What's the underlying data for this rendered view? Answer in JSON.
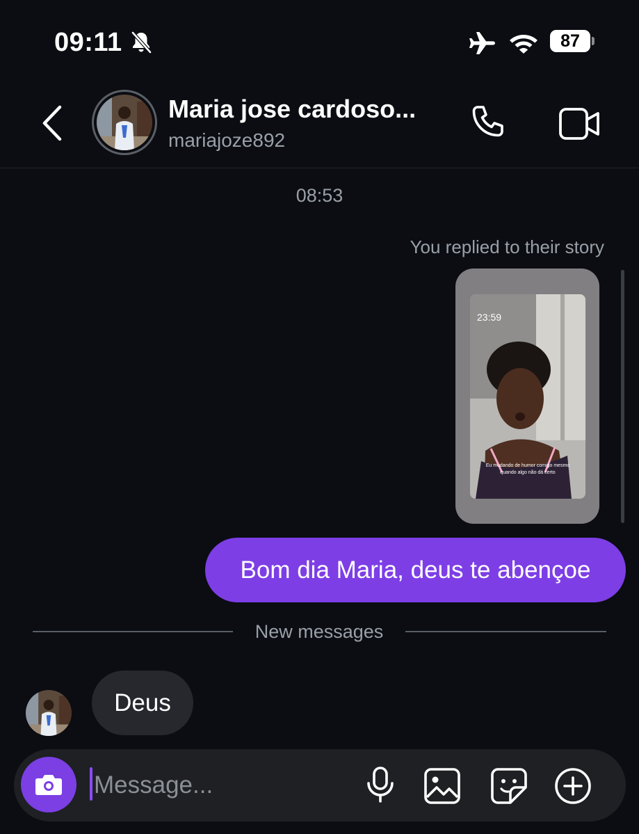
{
  "status_bar": {
    "time": "09:11",
    "battery": "87",
    "icons": [
      "bell-slash-icon",
      "airplane-icon",
      "wifi-icon",
      "battery-icon"
    ]
  },
  "header": {
    "name": "Maria jose cardoso...",
    "username": "mariajoze892",
    "icons": [
      "back-chevron-icon",
      "phone-icon",
      "video-camera-icon"
    ]
  },
  "conversation": {
    "timestamp": "08:53",
    "reply_note": "You replied to their story",
    "story": {
      "time_overlay": "23:59",
      "caption": "Eu mudando de humor comigo mesmo quando algo não dá certo"
    },
    "outgoing_message": "Bom dia Maria, deus te abençoe",
    "new_messages_label": "New messages",
    "incoming_message": "Deus"
  },
  "composer": {
    "placeholder": "Message...",
    "icons": [
      "camera-icon",
      "microphone-icon",
      "gallery-icon",
      "sticker-icon",
      "plus-circle-icon"
    ]
  },
  "colors": {
    "background": "#0b0d12",
    "accent_purple": "#7d3ee6",
    "incoming_bubble": "#26282e",
    "composer_bg": "#1e2024",
    "muted_text": "#9aa0a8"
  }
}
